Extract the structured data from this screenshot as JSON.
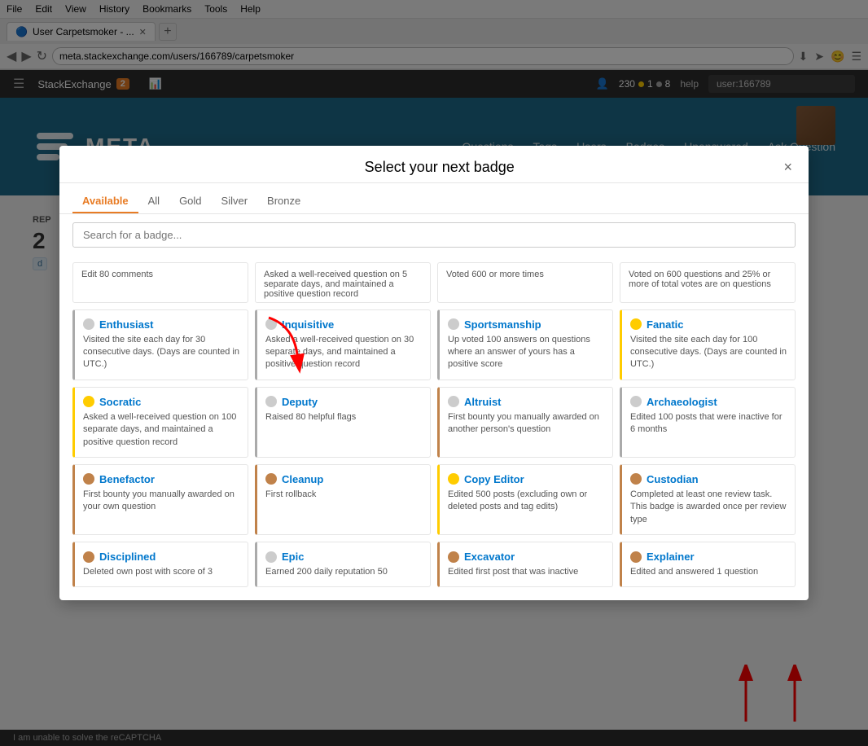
{
  "browser": {
    "menu_items": [
      "File",
      "Edit",
      "View",
      "History",
      "Bookmarks",
      "Tools",
      "Help"
    ],
    "tab_title": "User Carpetsmoker - ...",
    "address": "meta.stackexchange.com/users/166789/carpetsmoker",
    "new_tab_icon": "+"
  },
  "se_header": {
    "logo": "StackExchange",
    "notification_count": "2",
    "rep": "230",
    "gold": "1",
    "silver": "8",
    "help": "help",
    "search_placeholder": "user:166789"
  },
  "site_header": {
    "logo_text": "META",
    "nav": [
      "Questions",
      "Tags",
      "Users",
      "Badges",
      "Unanswered",
      "Ask Question"
    ]
  },
  "page": {
    "sidebar_label": "REP",
    "sidebar_value": "2",
    "sidebar_tag": "d"
  },
  "modal": {
    "title": "Select your next badge",
    "close_label": "×",
    "tabs": [
      "Available",
      "All",
      "Gold",
      "Silver",
      "Bronze"
    ],
    "active_tab": "Available",
    "search_placeholder": "Search for a badge...",
    "partial_top": [
      {
        "text": "Edit 80 comments"
      },
      {
        "text": "Asked a well-received question on 5 separate days, and maintained a positive question record"
      },
      {
        "text": "Voted 600 or more times"
      },
      {
        "text": "Voted on 600 questions and 25% or more of total votes are on questions"
      }
    ],
    "badges": [
      {
        "name": "Enthusiast",
        "icon": "gray",
        "desc": "Visited the site each day for 30 consecutive days. (Days are counted in UTC.)",
        "border": "silver"
      },
      {
        "name": "Inquisitive",
        "icon": "gray",
        "desc": "Asked a well-received question on 30 separate days, and maintained a positive question record",
        "border": "silver"
      },
      {
        "name": "Sportsmanship",
        "icon": "gray",
        "desc": "Up voted 100 answers on questions where an answer of yours has a positive score",
        "border": "silver"
      },
      {
        "name": "Fanatic",
        "icon": "gold",
        "desc": "Visited the site each day for 100 consecutive days. (Days are counted in UTC.)",
        "border": "gold"
      },
      {
        "name": "Socratic",
        "icon": "gold",
        "desc": "Asked a well-received question on 100 separate days, and maintained a positive question record",
        "border": "gold"
      },
      {
        "name": "Deputy",
        "icon": "gray",
        "desc": "Raised 80 helpful flags",
        "border": "silver"
      },
      {
        "name": "Altruist",
        "icon": "gray",
        "desc": "First bounty you manually awarded on another person's question",
        "border": "bronze"
      },
      {
        "name": "Archaeologist",
        "icon": "gray",
        "desc": "Edited 100 posts that were inactive for 6 months",
        "border": "silver"
      },
      {
        "name": "Benefactor",
        "icon": "bronze",
        "desc": "First bounty you manually awarded on your own question",
        "border": "bronze"
      },
      {
        "name": "Cleanup",
        "icon": "bronze",
        "desc": "First rollback",
        "border": "bronze"
      },
      {
        "name": "Copy Editor",
        "icon": "gold",
        "desc": "Edited 500 posts (excluding own or deleted posts and tag edits)",
        "border": "gold"
      },
      {
        "name": "Custodian",
        "icon": "bronze",
        "desc": "Completed at least one review task. This badge is awarded once per review type",
        "border": "bronze"
      },
      {
        "name": "Disciplined",
        "icon": "bronze",
        "desc": "Deleted own post with score of 3",
        "border": "bronze"
      },
      {
        "name": "Epic",
        "icon": "gray",
        "desc": "Earned 200 daily reputation 50",
        "border": "silver"
      },
      {
        "name": "Excavator",
        "icon": "bronze",
        "desc": "Edited first post that was inactive",
        "border": "bronze"
      },
      {
        "name": "Explainer",
        "icon": "bronze",
        "desc": "Edited and answered 1 question",
        "border": "bronze"
      }
    ]
  },
  "bottom_bar": {
    "message": "I am unable to solve the reCAPTCHA",
    "icon": "+"
  }
}
